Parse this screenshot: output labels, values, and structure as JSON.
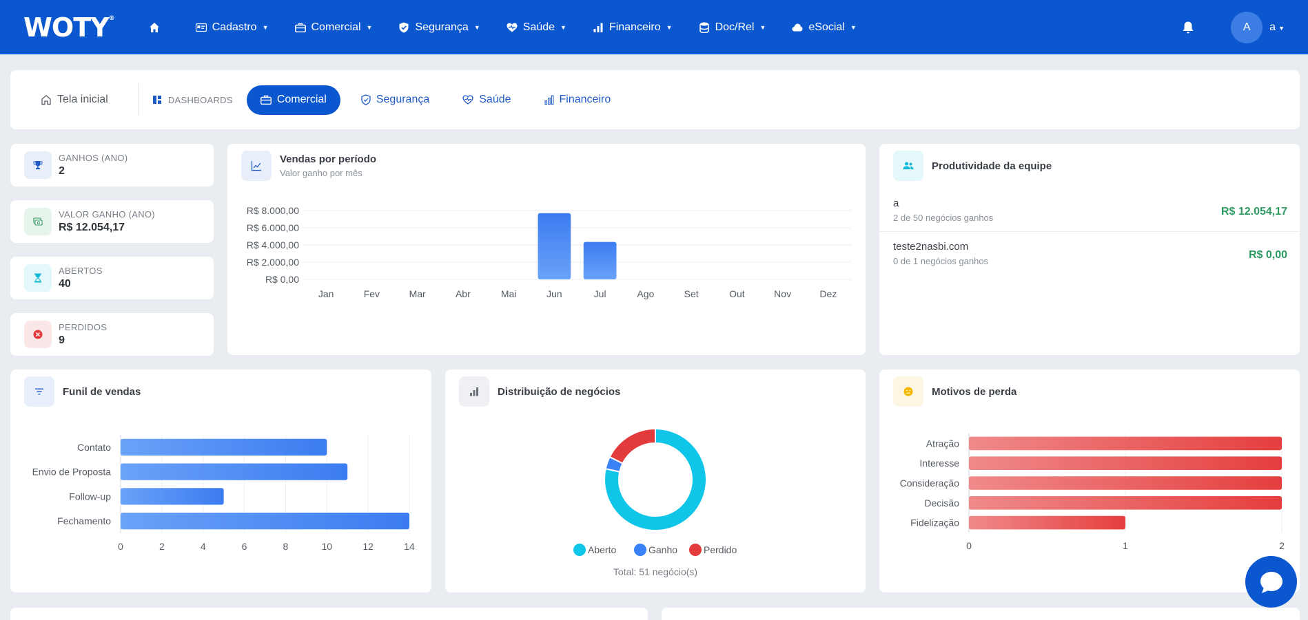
{
  "navbar": {
    "logo": "WOTY",
    "logo_mark": "®",
    "items": [
      {
        "label": "Cadastro",
        "icon": "id-card-icon"
      },
      {
        "label": "Comercial",
        "icon": "briefcase-icon"
      },
      {
        "label": "Segurança",
        "icon": "shield-icon"
      },
      {
        "label": "Saúde",
        "icon": "heart-pulse-icon"
      },
      {
        "label": "Financeiro",
        "icon": "bar-chart-icon"
      },
      {
        "label": "Doc/Rel",
        "icon": "database-icon"
      },
      {
        "label": "eSocial",
        "icon": "cloud-icon"
      }
    ],
    "avatar_initial": "A",
    "user_name": "a",
    "caret": "▼"
  },
  "tabs": {
    "home": "Tela inicial",
    "dashboards": "DASHBOARDS",
    "items": [
      {
        "label": "Comercial",
        "active": true
      },
      {
        "label": "Segurança",
        "active": false
      },
      {
        "label": "Saúde",
        "active": false
      },
      {
        "label": "Financeiro",
        "active": false
      }
    ]
  },
  "kpis": [
    {
      "label": "GANHOS (ANO)",
      "value": "2",
      "color": "#1f5bc6",
      "bg": "#e8effb",
      "icon": "trophy-icon"
    },
    {
      "label": "VALOR GANHO (ANO)",
      "value": "R$ 12.054,17",
      "color": "#2e9a62",
      "bg": "#e6f4ec",
      "icon": "money-icon"
    },
    {
      "label": "ABERTOS",
      "value": "40",
      "color": "#0fb8d6",
      "bg": "#e4f7fb",
      "icon": "hourglass-icon"
    },
    {
      "label": "PERDIDOS",
      "value": "9",
      "color": "#e03b3b",
      "bg": "#fbe7e7",
      "icon": "x-circle-icon"
    }
  ],
  "vendas": {
    "title": "Vendas por período",
    "subtitle": "Valor ganho por mês"
  },
  "team": {
    "title": "Produtividade da equipe",
    "rows": [
      {
        "name": "a",
        "sub": "2 de 50 negócios ganhos",
        "value": "R$ 12.054,17"
      },
      {
        "name": "teste2nasbi.com",
        "sub": "0 de 1 negócios ganhos",
        "value": "R$ 0,00"
      }
    ]
  },
  "funil": {
    "title": "Funil de vendas"
  },
  "dist": {
    "title": "Distribuição de negócios",
    "total": "Total: 51 negócio(s)"
  },
  "motivos": {
    "title": "Motivos de perda"
  },
  "chart_data": [
    {
      "type": "bar",
      "title": "Vendas por período",
      "subtitle": "Valor ganho por mês",
      "categories": [
        "Jan",
        "Fev",
        "Mar",
        "Abr",
        "Mai",
        "Jun",
        "Jul",
        "Ago",
        "Set",
        "Out",
        "Nov",
        "Dez"
      ],
      "values": [
        0,
        0,
        0,
        0,
        0,
        7700,
        4350,
        0,
        0,
        0,
        0,
        0
      ],
      "ylim": [
        0,
        8000
      ],
      "yticks": [
        0,
        2000,
        4000,
        6000,
        8000
      ],
      "ytick_labels": [
        "R$ 0,00",
        "R$ 2.000,00",
        "R$ 4.000,00",
        "R$ 6.000,00",
        "R$ 8.000,00"
      ],
      "color": "#4a8bf5",
      "grid": true
    },
    {
      "type": "bar",
      "orientation": "horizontal",
      "title": "Funil de vendas",
      "categories": [
        "Contato",
        "Envio de Proposta",
        "Follow-up",
        "Fechamento"
      ],
      "values": [
        10,
        11,
        5,
        14
      ],
      "xlim": [
        0,
        14
      ],
      "xticks": [
        0,
        2,
        4,
        6,
        8,
        10,
        12,
        14
      ],
      "color": "#4a8bf5",
      "grid": true
    },
    {
      "type": "pie",
      "title": "Distribuição de negócios",
      "donut": true,
      "labels": [
        "Aberto",
        "Ganho",
        "Perdido"
      ],
      "values": [
        40,
        2,
        9
      ],
      "colors": [
        "#0fc6e8",
        "#3b82f6",
        "#e33b3b"
      ],
      "legend": "bottom"
    },
    {
      "type": "bar",
      "orientation": "horizontal",
      "title": "Motivos de perda",
      "categories": [
        "Atração",
        "Interesse",
        "Consideração",
        "Decisão",
        "Fidelização"
      ],
      "values": [
        2,
        2,
        2,
        2,
        1
      ],
      "xlim": [
        0,
        2
      ],
      "xticks": [
        0,
        1,
        2
      ],
      "color": "#e84c4c",
      "grid": true
    }
  ]
}
